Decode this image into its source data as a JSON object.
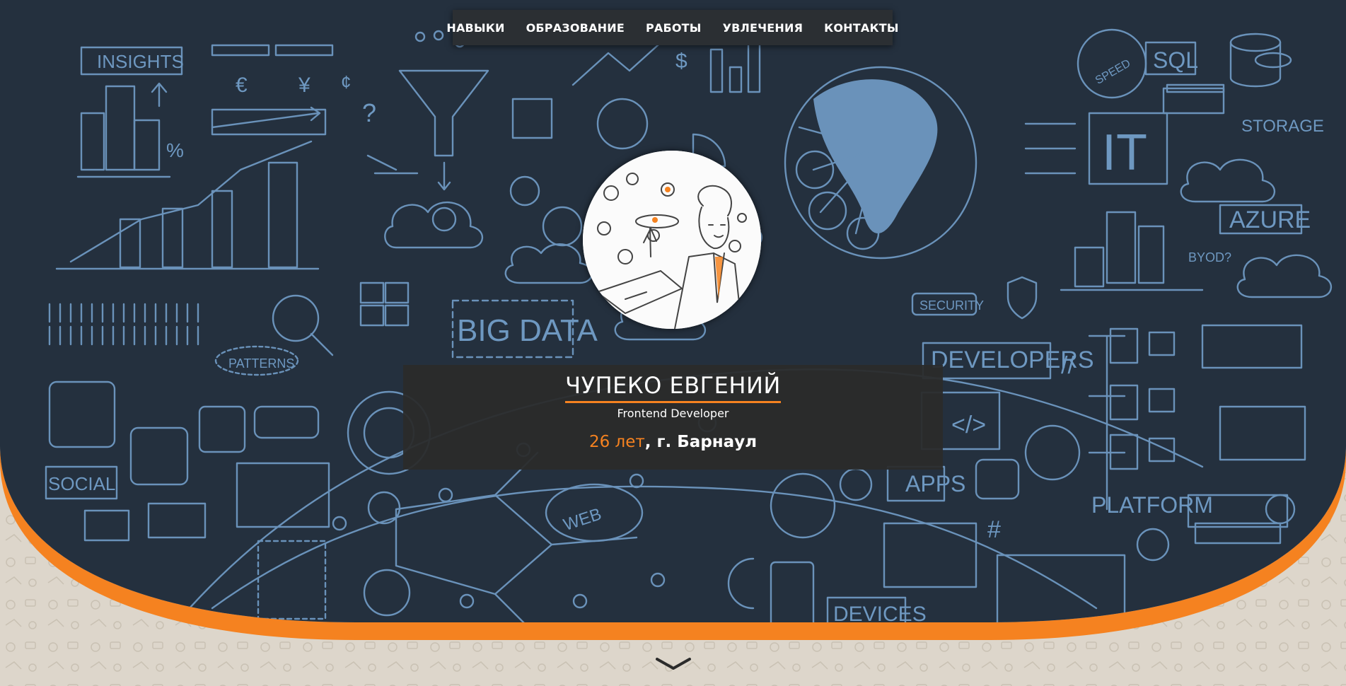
{
  "nav": {
    "items": [
      "НАВЫКИ",
      "ОБРАЗОВАНИЕ",
      "РАБОТЫ",
      "УВЛЕЧЕНИЯ",
      "КОНТАКТЫ"
    ]
  },
  "hero": {
    "name": "ЧУПЕКО ЕВГЕНИЙ",
    "role": "Frontend Developer",
    "age": "26 лет",
    "city": ", г. Барнаул"
  },
  "doodles": {
    "insights": "INSIGHTS",
    "big_data": "BIG DATA",
    "patterns": "PATTERNS",
    "social": "SOCIAL",
    "web": "WEB",
    "developers": "DEVELOPERS",
    "apps": "APPS",
    "platform": "PLATFORM",
    "devices": "DEVICES",
    "security": "SECURITY",
    "it": "IT",
    "sql": "SQL",
    "storage": "STORAGE",
    "azure": "AZURE",
    "byod": "BYOD?",
    "speed": "SPEED",
    "code": "</>",
    "euro": "€",
    "yen": "¥",
    "cent": "¢",
    "dollar": "$",
    "percent": "%",
    "question": "?",
    "hash": "#",
    "slashes": "//"
  },
  "colors": {
    "hero_bg": "#24303e",
    "doodle": "#6e98c1",
    "accent": "#f58220",
    "page_bg": "#ddd6cb",
    "panel": "#2b2b2b"
  },
  "icons": {
    "scroll": "chevron-down-icon",
    "avatar": "developer-illustration"
  }
}
